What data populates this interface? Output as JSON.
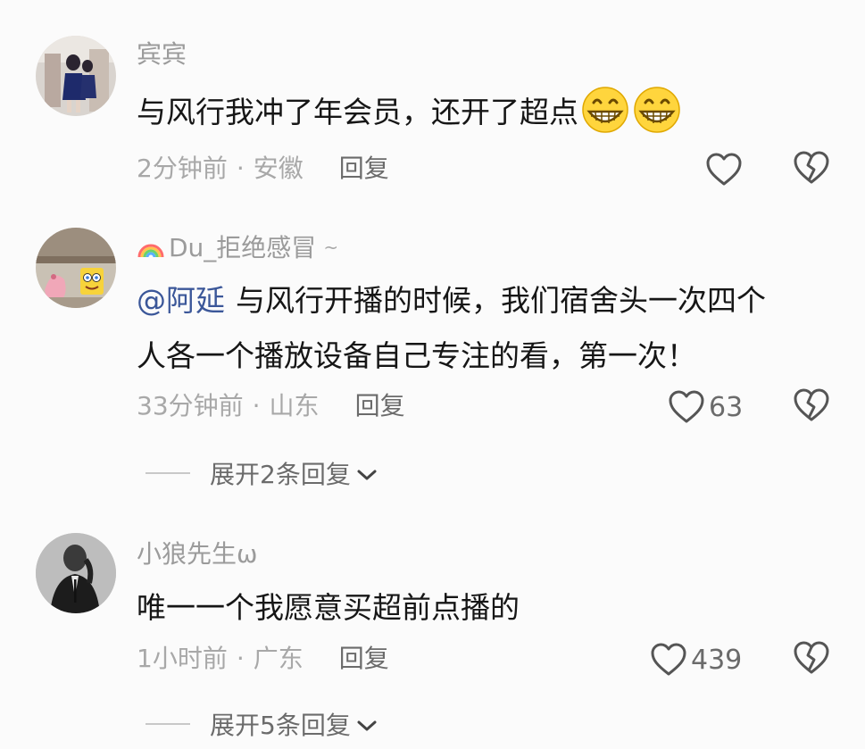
{
  "comments": [
    {
      "username": "宾宾",
      "text": "与风行我冲了年会员，还开了超点",
      "emojis": [
        "grinning-face",
        "grinning-face"
      ],
      "time": "2分钟前",
      "location": "安徽",
      "reply_label": "回复",
      "like_count": ""
    },
    {
      "username": "Du_拒绝感冒",
      "username_prefix_icon": "rainbow-icon",
      "username_suffix": "~",
      "mention": "@阿延",
      "text_line1": "与风行开播的时候，我们宿舍头一次四个",
      "text_line2": "人各一个播放设备自己专注的看，第一次！",
      "time": "33分钟前",
      "location": "山东",
      "reply_label": "回复",
      "like_count": "63",
      "expand_label": "展开2条回复"
    },
    {
      "username": "小狼先生ω",
      "text": "唯一一个我愿意买超前点播的",
      "time": "1小时前",
      "location": "广东",
      "reply_label": "回复",
      "like_count": "439",
      "expand_label": "展开5条回复"
    }
  ],
  "separator": "·",
  "icons": {
    "like": "heart-outline-icon",
    "dislike": "broken-heart-icon",
    "expand": "chevron-down-icon"
  },
  "colors": {
    "background": "#fbfbfb",
    "text": "#161616",
    "muted": "#a8a8a8",
    "username": "#9b9b9b",
    "mention": "#3b5799"
  }
}
